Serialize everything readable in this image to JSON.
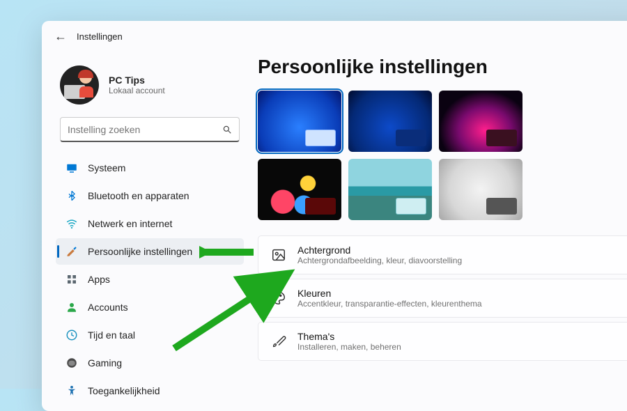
{
  "titlebar": {
    "title": "Instellingen"
  },
  "user": {
    "name": "PC Tips",
    "sub": "Lokaal account"
  },
  "search": {
    "placeholder": "Instelling zoeken"
  },
  "nav": {
    "system": "Systeem",
    "bluetooth": "Bluetooth en apparaten",
    "network": "Netwerk en internet",
    "personalization": "Persoonlijke instellingen",
    "apps": "Apps",
    "accounts": "Accounts",
    "time": "Tijd en taal",
    "gaming": "Gaming",
    "accessibility": "Toegankelijkheid"
  },
  "page": {
    "title": "Persoonlijke instellingen"
  },
  "settings": {
    "background": {
      "title": "Achtergrond",
      "desc": "Achtergrondafbeelding, kleur, diavoorstelling"
    },
    "colors": {
      "title": "Kleuren",
      "desc": "Accentkleur, transparantie-effecten, kleurenthema"
    },
    "themes": {
      "title": "Thema's",
      "desc": "Installeren, maken, beheren"
    }
  }
}
